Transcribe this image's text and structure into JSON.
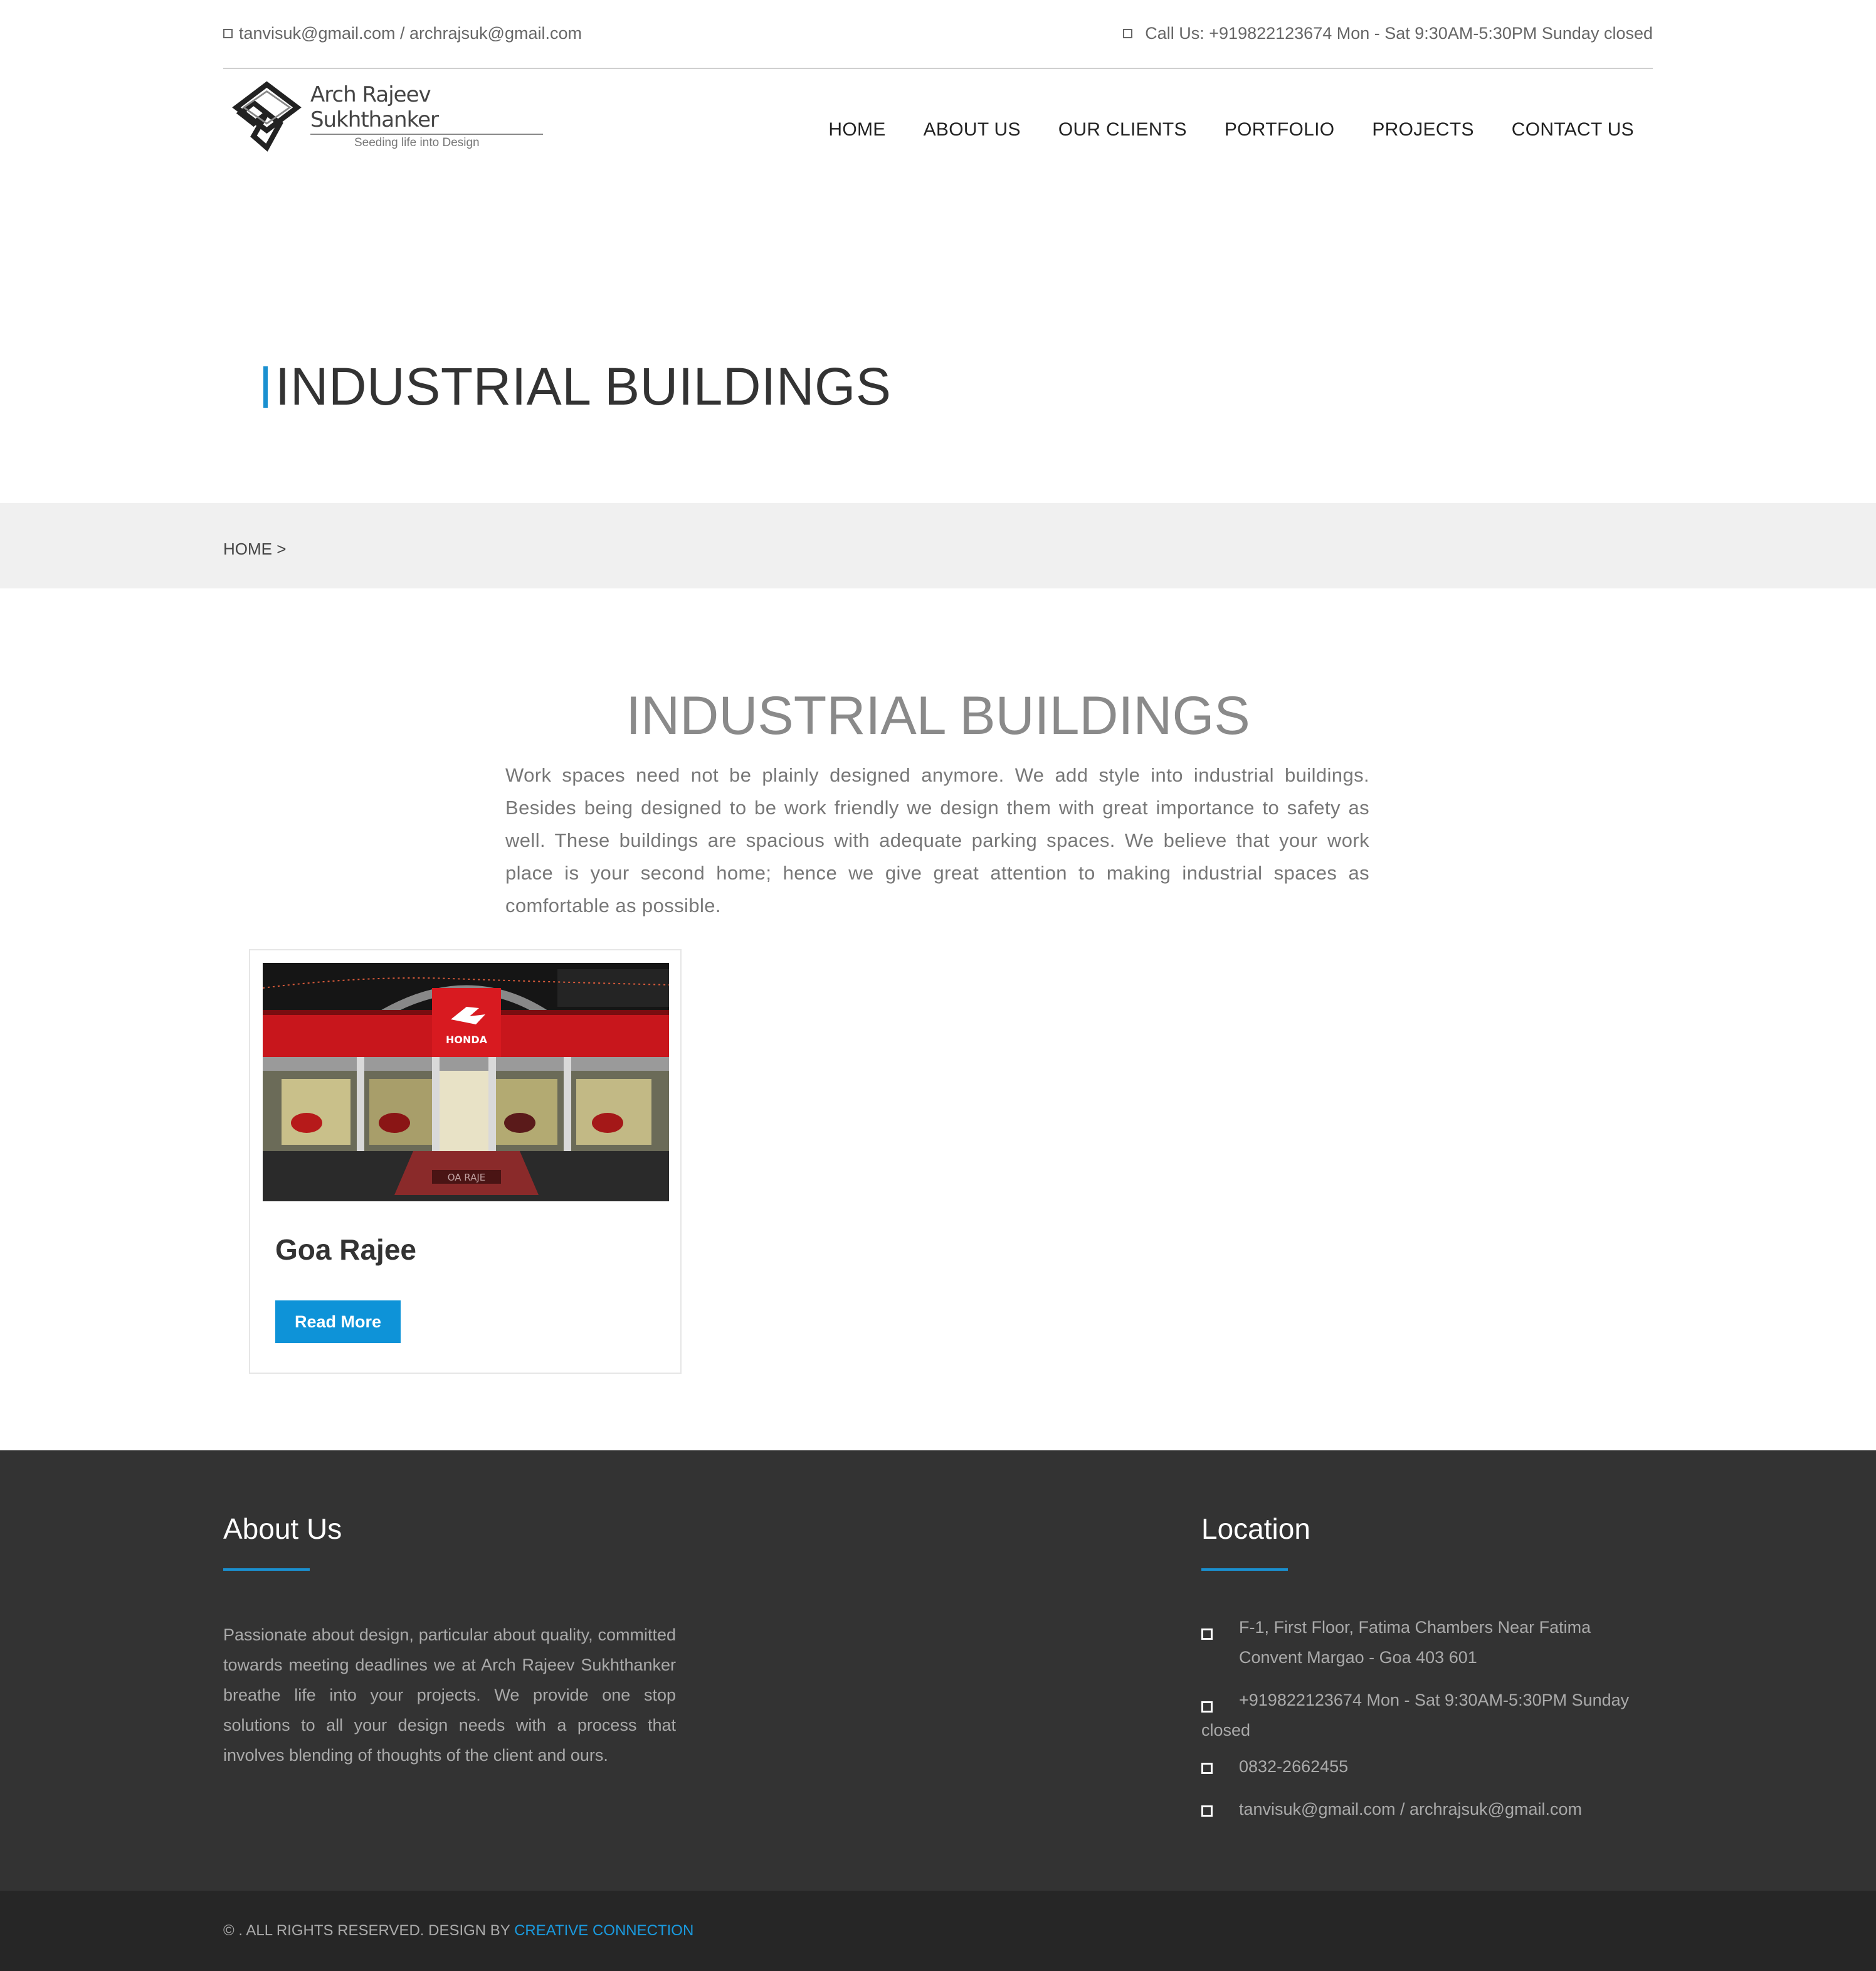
{
  "topbar": {
    "email": "tanvisuk@gmail.com / archrajsuk@gmail.com",
    "phone": "Call Us: +919822123674 Mon - Sat 9:30AM-5:30PM Sunday closed"
  },
  "logo": {
    "name": "Arch Rajeev Sukhthanker",
    "tagline": "Seeding life into Design"
  },
  "nav": [
    "HOME",
    "ABOUT US",
    "OUR CLIENTS",
    "PORTFOLIO",
    "PROJECTS",
    "CONTACT US"
  ],
  "page": {
    "title": "INDUSTRIAL BUILDINGS",
    "breadcrumb": "HOME >"
  },
  "intro": {
    "title": "INDUSTRIAL BUILDINGS",
    "text": "Work spaces need not be plainly designed anymore. We add style into industrial buildings. Besides being designed to be work friendly we design them with great importance to safety as well. These buildings are spacious with adequate parking spaces. We believe that your work place is your second home; hence we give great attention to making industrial spaces as comfortable as possible."
  },
  "projects": [
    {
      "title": "Goa Rajee",
      "button": "Read More",
      "image_sign": "HONDA",
      "image_plate": "OA RAJE"
    }
  ],
  "footer": {
    "about": {
      "heading": "About Us",
      "text": "Passionate about design, particular about quality, committed towards meeting deadlines we at Arch Rajeev Sukhthanker breathe life into your projects. We provide one stop solutions to all your design needs with a process that involves blending of thoughts of the client and ours."
    },
    "location": {
      "heading": "Location",
      "address_line1": "F-1, First Floor, Fatima Chambers Near Fatima",
      "address_line2": "Convent Margao - Goa 403 601",
      "phone_line1": "+919822123674 Mon - Sat 9:30AM-5:30PM Sunday",
      "phone_line2": "closed",
      "landline": "0832-2662455",
      "email": "tanvisuk@gmail.com / archrajsuk@gmail.com"
    }
  },
  "bottom": {
    "copyright": "© . ALL RIGHTS RESERVED. DESIGN BY",
    "designer": "CREATIVE CONNECTION"
  },
  "colors": {
    "accent": "#1a90d0",
    "button": "#0e93d8",
    "footer_bg": "#333333",
    "bottom_bg": "#262626",
    "crumb_bg": "#f0f0f0"
  }
}
